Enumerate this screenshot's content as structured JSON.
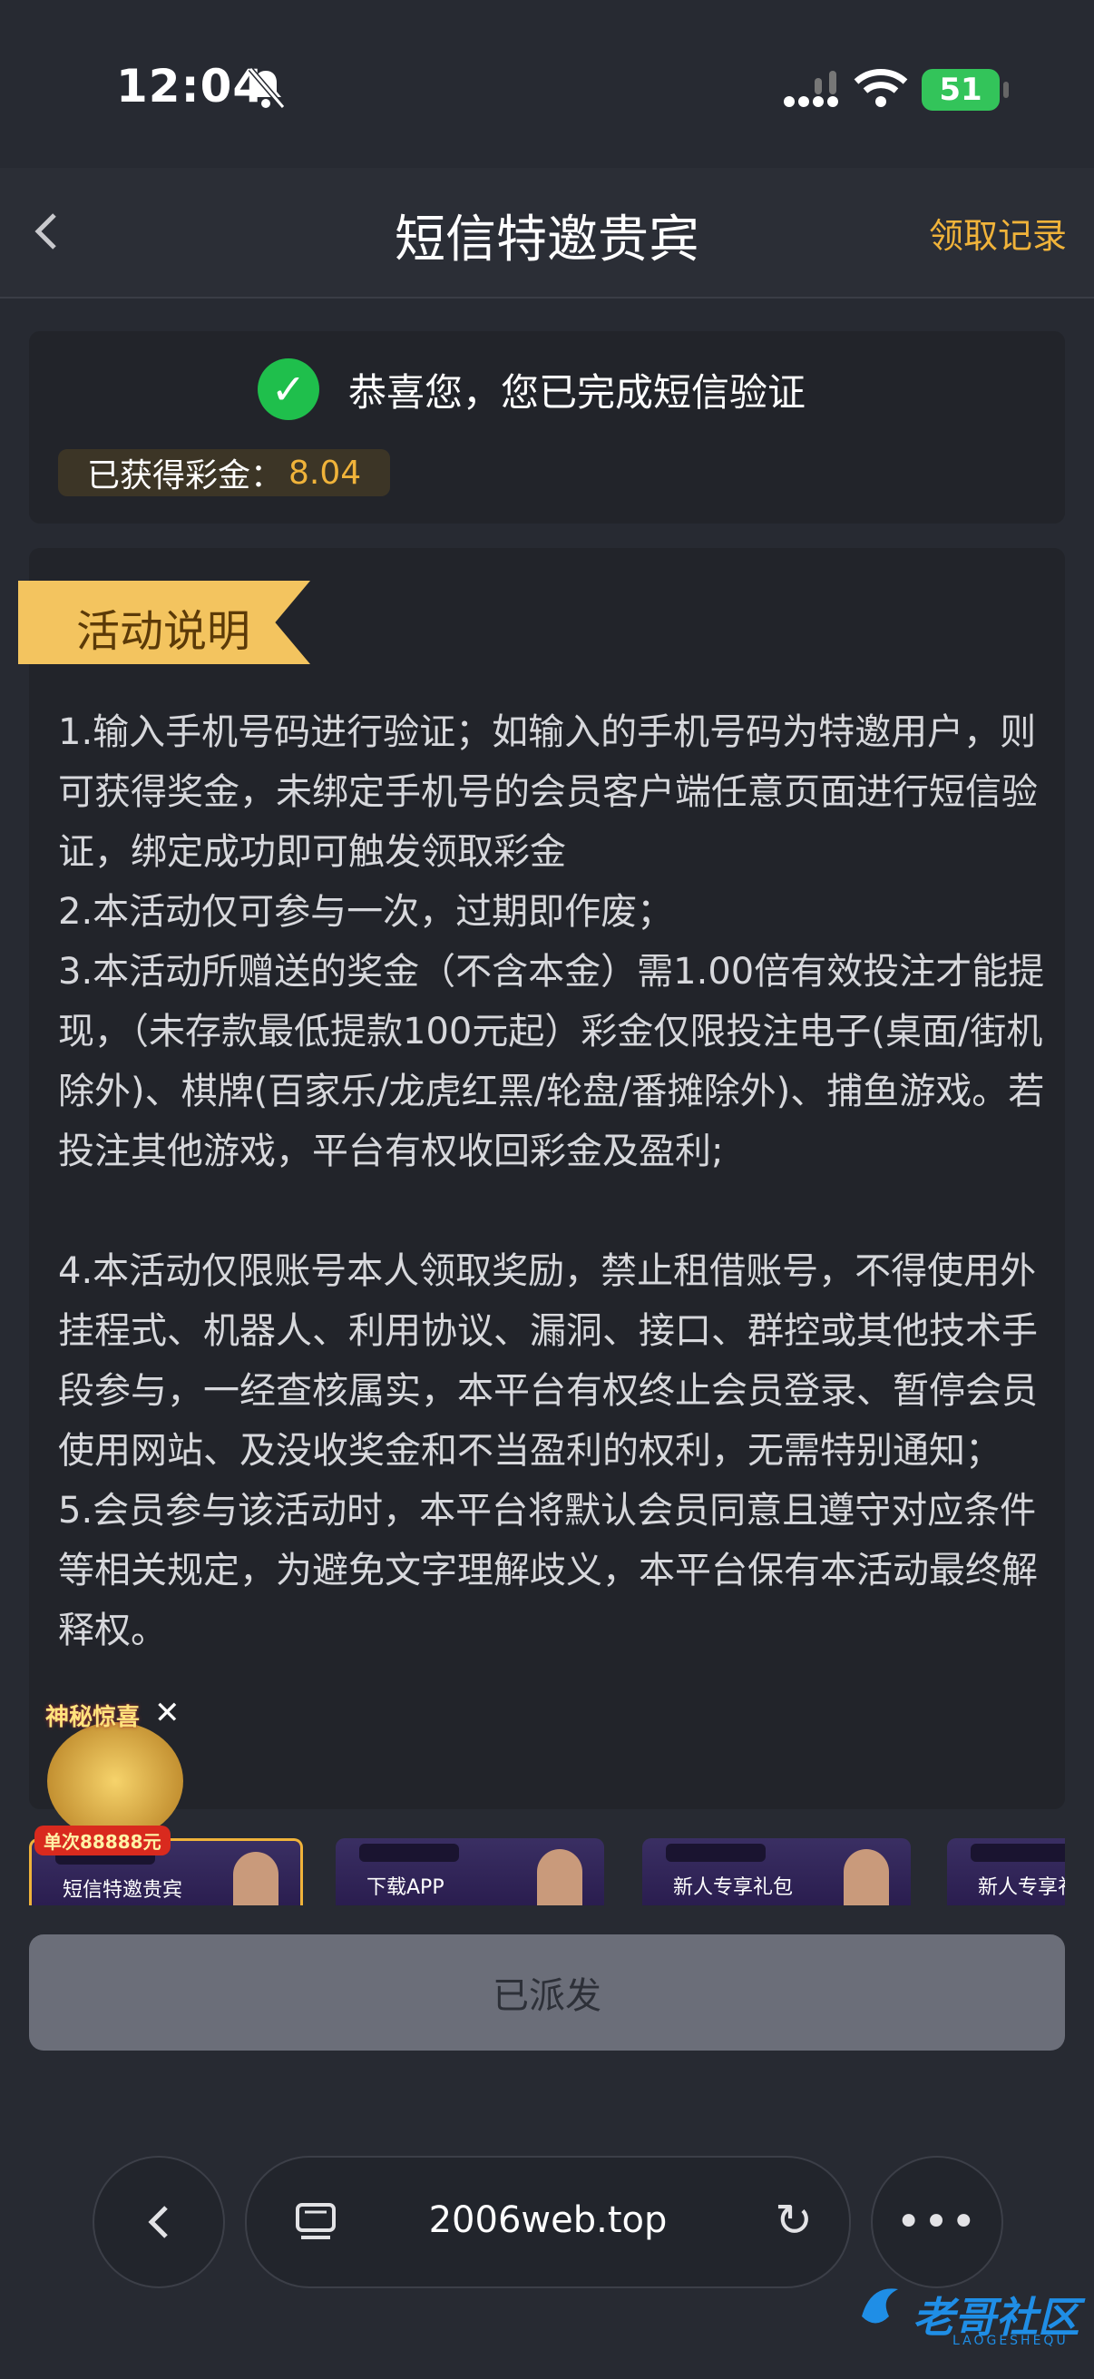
{
  "status_bar": {
    "time": "12:04",
    "battery": "51"
  },
  "header": {
    "back_label": "<",
    "title": "短信特邀贵宾",
    "records_label": "领取记录"
  },
  "success": {
    "message": "恭喜您，您已完成短信验证",
    "bonus_label": "已获得彩金：",
    "bonus_value": "8.04"
  },
  "activity": {
    "tag": "活动说明",
    "text": "1.输入手机号码进行验证；如输入的手机号码为特邀用户，则可获得奖金，未绑定手机号的会员客户端任意页面进行短信验证，绑定成功即可触发领取彩金\n2.本活动仅可参与一次，过期即作废；\n3.本活动所赠送的奖金（不含本金）需1.00倍有效投注才能提现，（未存款最低提款100元起）彩金仅限投注电子(桌面/街机除外)、棋牌(百家乐/龙虎红黑/轮盘/番摊除外)、捕鱼游戏。若投注其他游戏，平台有权收回彩金及盈利;\n\n4.本活动仅限账号本人领取奖励，禁止租借账号，不得使用外挂程式、机器人、利用协议、漏洞、接口、群控或其他技术手段参与，一经查核属实，本平台有权终止会员登录、暂停会员使用网站、及没收奖金和不当盈利的权利，无需特别通知；\n5.会员参与该活动时，本平台将默认会员同意且遵守对应条件等相关规定，为避免文字理解歧义，本平台保有本活动最终解释权。"
  },
  "promo": {
    "title": "神秘惊喜",
    "badge": "单次88888元"
  },
  "banners": [
    {
      "label": "短信特邀贵宾"
    },
    {
      "label": "下载APP"
    },
    {
      "label": "新人专享礼包"
    },
    {
      "label": "新人专享礼包"
    }
  ],
  "dispatch_button": "已派发",
  "browser": {
    "url": "2006web.top"
  },
  "watermark": {
    "text": "老哥社区",
    "sub": "LAOGESHEQU"
  },
  "colors": {
    "accent": "#f0b33a",
    "success": "#1fbf4c",
    "background": "#272a32"
  }
}
